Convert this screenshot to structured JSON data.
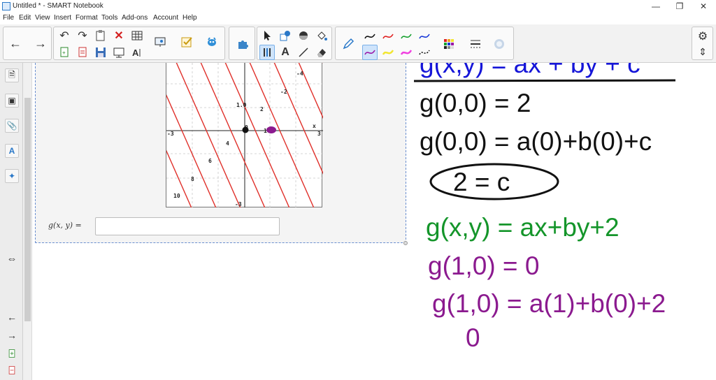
{
  "window": {
    "title": "Untitled * - SMART Notebook",
    "minimize": "—",
    "restore": "❐",
    "close": "✕"
  },
  "menu": [
    "File",
    "Edit",
    "View",
    "Insert",
    "Format",
    "Tools",
    "Add-ons",
    "Account",
    "Help"
  ],
  "toolbar": {
    "back_icon": "←",
    "forward_icon": "→",
    "undo_icon": "↶",
    "redo_icon": "↷",
    "delete_icon": "✕",
    "text_tool_label": "A",
    "settings_icon": "⚙",
    "move_toolbar_icon": "⇕"
  },
  "sidebar": {
    "page_sorter_icon": "🗎",
    "gallery_icon": "▣",
    "attachments_icon": "📎",
    "properties_icon": "A",
    "addons_icon": "✦",
    "resize_icon": "⇔",
    "prev_page_icon": "←",
    "next_page_icon": "→"
  },
  "graph": {
    "contour_labels": [
      "-4",
      "-2",
      "0",
      "2",
      "4",
      "6",
      "8",
      "10",
      "-3",
      "3",
      "1.0",
      "1.0",
      "-3",
      "x"
    ]
  },
  "question": {
    "label": "g(x, y) =",
    "answer_value": ""
  },
  "handwriting": {
    "line1": "g(x,y) = ax + by + c",
    "line2": "g(0,0) = 2",
    "line3": "g(0,0) = a(0)+b(0)+c",
    "line4": "2 = c",
    "line5": "g(x,y) = ax+by+2",
    "line6": "g(1,0) = 0",
    "line7": "g(1,0) = a(1)+b(0)+2",
    "line8": "0"
  },
  "colors": {
    "blue_ink": "#1515d8",
    "black_ink": "#111111",
    "green_ink": "#14952a",
    "purple_ink": "#8b1a8f",
    "contour_red": "#e0302a"
  }
}
